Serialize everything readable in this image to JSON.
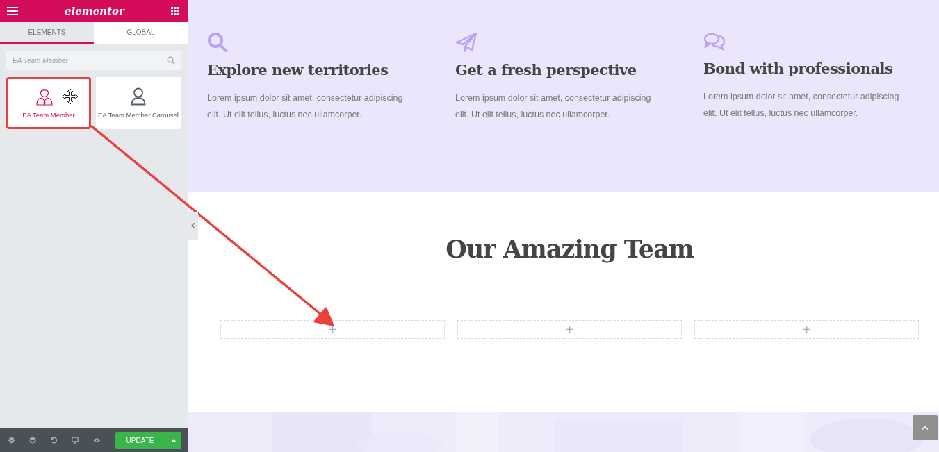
{
  "sidebar": {
    "logo": "elementor",
    "tabs": [
      {
        "label": "ELEMENTS",
        "selected": true
      },
      {
        "label": "GLOBAL",
        "selected": false
      }
    ],
    "search": {
      "placeholder": "EA Team Member"
    },
    "widgets": [
      {
        "kind": "member",
        "label": "EA Team Member",
        "selected": true
      },
      {
        "kind": "carousel",
        "label": "EA Team Member Carousel",
        "selected": false
      }
    ],
    "update_button": "UPDATE"
  },
  "canvas": {
    "features": [
      {
        "kind": "search",
        "title": "Explore new territories",
        "text": "Lorem ipsum dolor sit amet, consectetur adipiscing elit. Ut elit tellus, luctus nec ullamcorper."
      },
      {
        "kind": "plane",
        "title": "Get a fresh perspective",
        "text": "Lorem ipsum dolor sit amet, consectetur adipiscing elit. Ut elit tellus, luctus nec ullamcorper."
      },
      {
        "kind": "chat",
        "title": "Bond with professionals",
        "text": "Lorem ipsum dolor sit amet, consectetur adipiscing elit. Ut elit tellus, luctus nec ullamcorper."
      }
    ],
    "team_heading": "Our Amazing Team",
    "add_slots": [
      "+",
      "+",
      "+"
    ]
  }
}
